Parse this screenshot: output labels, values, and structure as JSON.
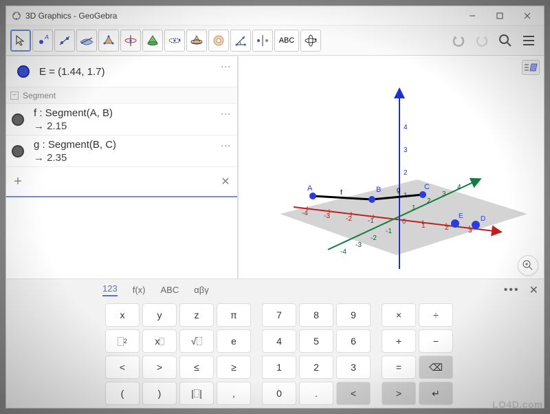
{
  "window": {
    "title": "3D Graphics - GeoGebra"
  },
  "toolbar": {
    "tools": [
      "move",
      "point",
      "line",
      "plane",
      "polygon",
      "circle-axis",
      "cone",
      "sphere",
      "intersect",
      "net",
      "angle",
      "reflect",
      "text",
      "rotate-view"
    ],
    "actions": [
      "undo",
      "redo",
      "search",
      "menu"
    ]
  },
  "algebra": {
    "point": {
      "label": "E = (1.44, 1.7)"
    },
    "category": "Segment",
    "items": [
      {
        "def": "f : Segment(A, B)",
        "val": "→  2.15"
      },
      {
        "def": "g : Segment(B, C)",
        "val": "→  2.35"
      }
    ],
    "input_placeholder": ""
  },
  "view3d": {
    "pointLabels": [
      "A",
      "B",
      "C",
      "D",
      "E"
    ],
    "segmentLabels": [
      "f",
      "g"
    ],
    "axisTicks": {
      "x": [
        -4,
        -3,
        -2,
        -1,
        1,
        2,
        3
      ],
      "y": [
        -4,
        -3,
        -2,
        -1,
        1,
        2,
        3,
        4
      ],
      "z": [
        1,
        2,
        3,
        4
      ]
    }
  },
  "keyboard": {
    "tabs": [
      "123",
      "f(x)",
      "ABC",
      "αβγ"
    ],
    "rows": [
      [
        "x",
        "y",
        "z",
        "π",
        "7",
        "8",
        "9",
        "×",
        "÷"
      ],
      [
        "▯²",
        "xⁿ",
        "√▯",
        "e",
        "4",
        "5",
        "6",
        "+",
        "−"
      ],
      [
        "<",
        ">",
        "≤",
        "≥",
        "1",
        "2",
        "3",
        "=",
        "⌫"
      ],
      [
        "(",
        ")",
        "|▯|",
        ",",
        "0",
        ".",
        "<",
        ">",
        "↵"
      ]
    ]
  },
  "watermark": "LO4D.com"
}
